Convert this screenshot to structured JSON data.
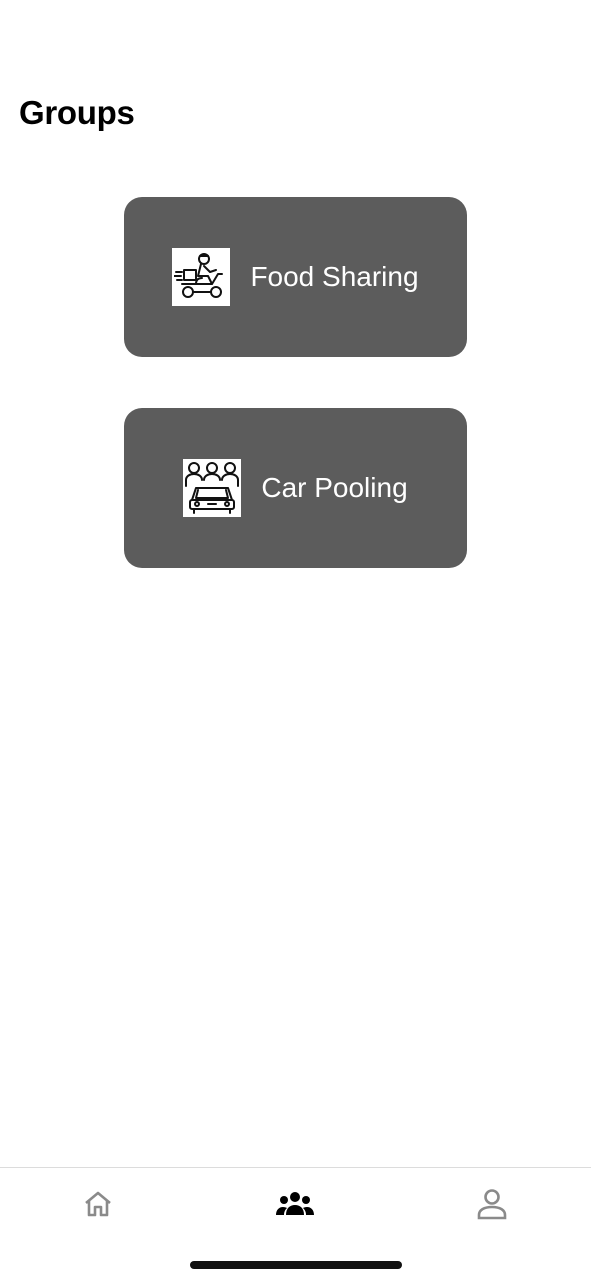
{
  "header": {
    "title": "Groups"
  },
  "groups": [
    {
      "label": "Food Sharing",
      "icon": "delivery-scooter-icon"
    },
    {
      "label": "Car Pooling",
      "icon": "carpool-people-car-icon"
    }
  ],
  "tab_bar": {
    "tabs": [
      {
        "icon": "home-icon",
        "active": false
      },
      {
        "icon": "group-icon",
        "active": true
      },
      {
        "icon": "profile-icon",
        "active": false
      }
    ],
    "active_color": "#000000",
    "inactive_color": "#8a8a8a"
  },
  "colors": {
    "card_background": "#5c5c5c",
    "card_text": "#ffffff"
  }
}
